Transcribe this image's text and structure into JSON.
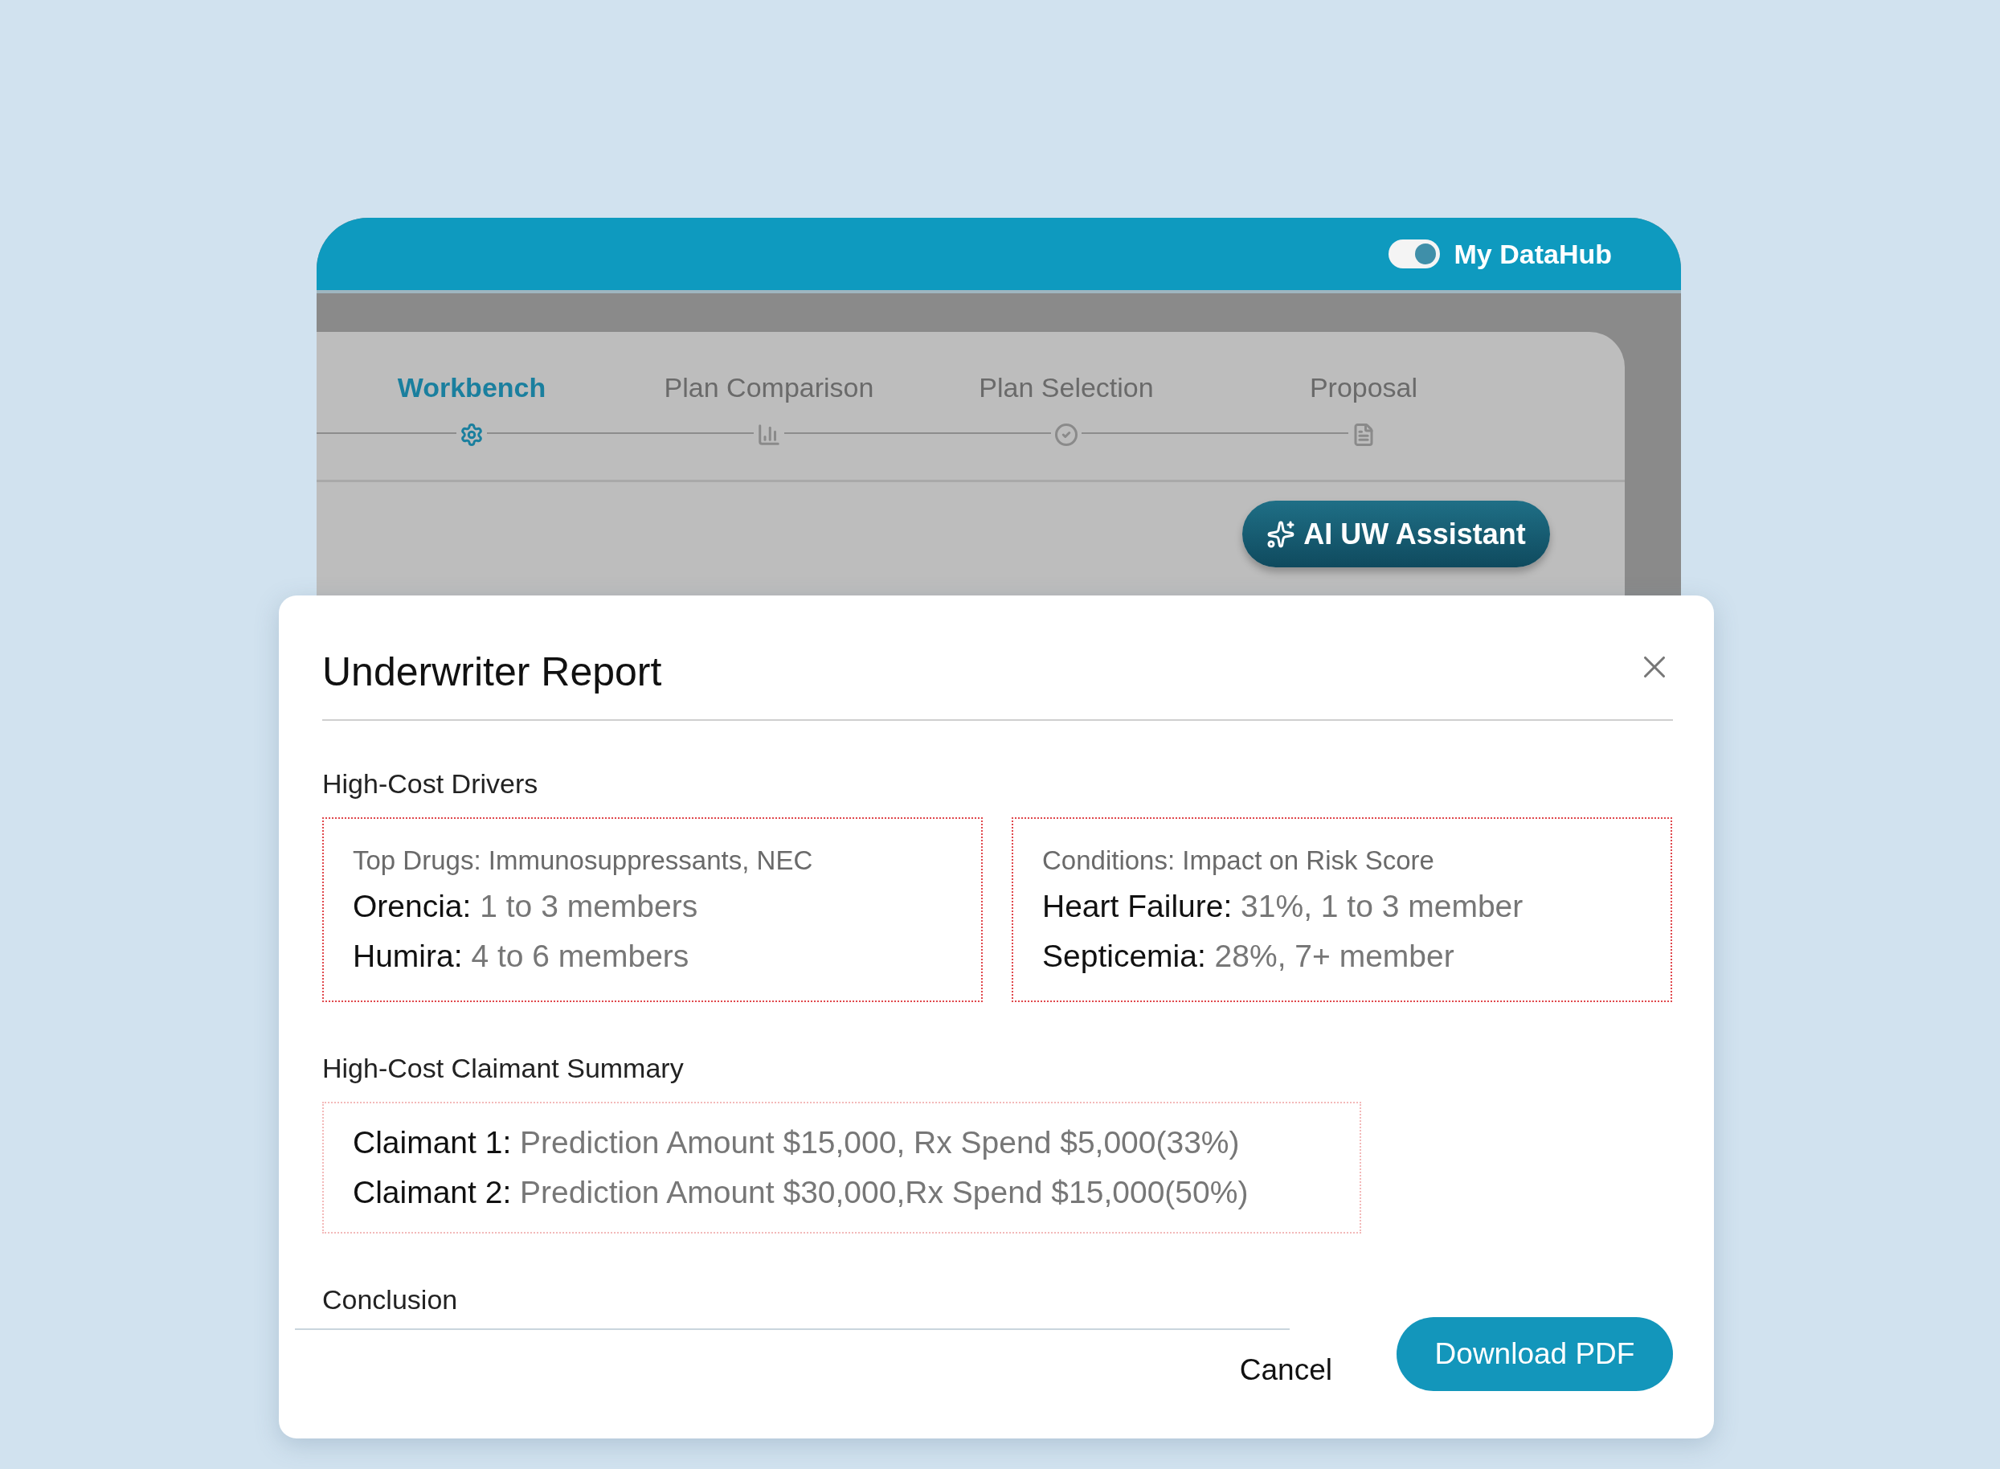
{
  "app_header": {
    "toggle": {
      "label": "My DataHub",
      "on": true
    }
  },
  "steps": [
    {
      "label": "Workbench",
      "selected": true
    },
    {
      "label": "Plan Comparison",
      "selected": false
    },
    {
      "label": "Plan Selection",
      "selected": false
    },
    {
      "label": "Proposal",
      "selected": false
    }
  ],
  "assistant_button": {
    "label": "AI UW Assistant"
  },
  "dialog": {
    "title": "Underwriter Report",
    "sections": [
      {
        "heading": "High-Cost Drivers",
        "cards": [
          {
            "caption": "Top Drugs: Immunosuppressants, NEC",
            "rows": [
              {
                "name": "Orencia:",
                "value": "1 to 3 members"
              },
              {
                "name": "Humira:",
                "value": "4 to 6 members"
              }
            ]
          },
          {
            "caption": "Conditions: Impact on Risk Score",
            "rows": [
              {
                "name": "Heart Failure:",
                "value": "31%, 1 to 3 member"
              },
              {
                "name": "Septicemia:",
                "value": "28%, 7+ member"
              }
            ]
          }
        ]
      },
      {
        "heading": "High-Cost Claimant Summary",
        "cards": [
          {
            "rows": [
              {
                "name": "Claimant 1:",
                "value": "Prediction Amount $15,000, Rx Spend $5,000(33%)"
              },
              {
                "name": "Claimant 2:",
                "value": "Prediction Amount $30,000,Rx Spend $15,000(50%)"
              }
            ]
          }
        ]
      },
      {
        "heading": "Conclusion"
      }
    ],
    "buttons": [
      {
        "label": "Cancel",
        "kind": "text"
      },
      {
        "label": "Download PDF",
        "kind": "primary"
      }
    ]
  }
}
